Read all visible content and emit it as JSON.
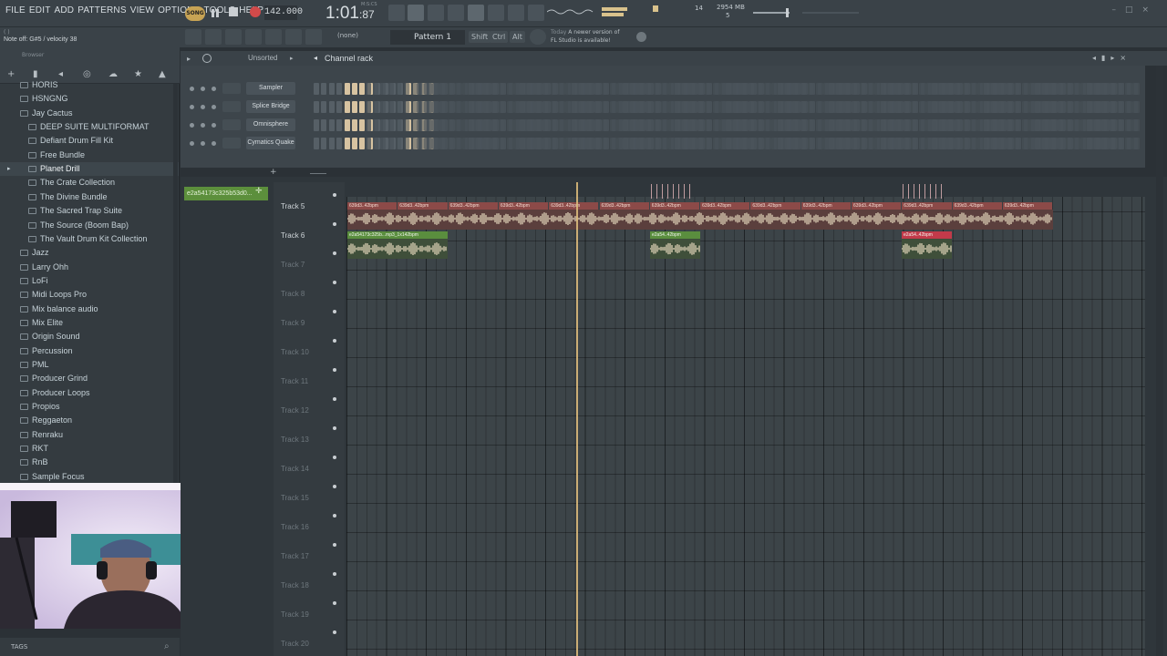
{
  "menu": [
    "FILE",
    "EDIT",
    "ADD",
    "PATTERNS",
    "VIEW",
    "OPTIONS",
    "TOOLS",
    "HELP"
  ],
  "transport": {
    "mode": "SONG",
    "tempo": "142.000",
    "time_label": "M:S:CS",
    "time_main": "1:01",
    "time_cs": ":87",
    "poly": "14",
    "cpu_mem": "2954 MB",
    "cpu_num": "5"
  },
  "hint": {
    "top": "( )",
    "text": "Note off: G#5 / velocity 38"
  },
  "toolbar2": {
    "snap": "(none)",
    "pattern": "Pattern 1",
    "keys": [
      "Shift",
      "Ctrl",
      "Alt"
    ],
    "news_time": "Today",
    "news_line1": "A newer version of",
    "news_line2": "FL Studio is available!"
  },
  "browser": {
    "title": "Browser",
    "items": [
      {
        "label": "HORIS",
        "level": 1,
        "folder": true
      },
      {
        "label": "HSNGNG",
        "level": 1,
        "folder": true
      },
      {
        "label": "Jay Cactus",
        "level": 1,
        "folder": true,
        "open": true
      },
      {
        "label": "DEEP SUITE MULTIFORMAT",
        "level": 2,
        "folder": true
      },
      {
        "label": "Defiant Drum Fill Kit",
        "level": 2,
        "folder": true
      },
      {
        "label": "Free Bundle",
        "level": 2,
        "folder": true
      },
      {
        "label": "Planet Drill",
        "level": 2,
        "folder": true,
        "highlight": true
      },
      {
        "label": "The Crate Collection",
        "level": 2,
        "folder": true
      },
      {
        "label": "The Divine Bundle",
        "level": 2,
        "folder": true
      },
      {
        "label": "The Sacred Trap Suite",
        "level": 2,
        "folder": true
      },
      {
        "label": "The Source (Boom Bap)",
        "level": 2,
        "folder": true
      },
      {
        "label": "The Vault Drum Kit Collection",
        "level": 2,
        "folder": true
      },
      {
        "label": "Jazz",
        "level": 1,
        "folder": true
      },
      {
        "label": "Larry Ohh",
        "level": 1,
        "folder": true
      },
      {
        "label": "LoFi",
        "level": 1,
        "folder": true
      },
      {
        "label": "Midi Loops Pro",
        "level": 1,
        "folder": true
      },
      {
        "label": "Mix balance audio",
        "level": 1,
        "folder": true
      },
      {
        "label": "Mix Elite",
        "level": 1,
        "folder": true
      },
      {
        "label": "Origin Sound",
        "level": 1,
        "folder": true
      },
      {
        "label": "Percussion",
        "level": 1,
        "folder": true
      },
      {
        "label": "PML",
        "level": 1,
        "folder": true
      },
      {
        "label": "Producer Grind",
        "level": 1,
        "folder": true
      },
      {
        "label": "Producer Loops",
        "level": 1,
        "folder": true
      },
      {
        "label": "Propios",
        "level": 1,
        "folder": true
      },
      {
        "label": "Reggaeton",
        "level": 1,
        "folder": true
      },
      {
        "label": "Renraku",
        "level": 1,
        "folder": true
      },
      {
        "label": "RKT",
        "level": 1,
        "folder": true
      },
      {
        "label": "RnB",
        "level": 1,
        "folder": true
      },
      {
        "label": "Sample Focus",
        "level": 1,
        "folder": true
      }
    ],
    "tags": "TAGS"
  },
  "channel_rack": {
    "title": "Channel rack",
    "sort": "Unsorted",
    "channels": [
      {
        "name": "Sampler",
        "steps": [
          0,
          0,
          0,
          0,
          1,
          1,
          1,
          1,
          0,
          0,
          0,
          0,
          1,
          1,
          1,
          1
        ]
      },
      {
        "name": "Splice Bridge",
        "steps": [
          0,
          0,
          0,
          0,
          1,
          1,
          1,
          1,
          0,
          0,
          0,
          0,
          1,
          1,
          1,
          1
        ]
      },
      {
        "name": "Omnisphere",
        "steps": [
          0,
          0,
          0,
          0,
          1,
          1,
          1,
          1,
          0,
          0,
          0,
          0,
          1,
          1,
          1,
          1
        ]
      },
      {
        "name": "Cymatics Quake",
        "steps": [
          0,
          0,
          0,
          0,
          1,
          1,
          1,
          1,
          0,
          0,
          0,
          0,
          1,
          1,
          1,
          1
        ]
      }
    ]
  },
  "playlist": {
    "pattern_selector": "e2a54173c325b53d0...",
    "tracks": [
      "Track 5",
      "Track 6",
      "Track 7",
      "Track 8",
      "Track 9",
      "Track 10",
      "Track 11",
      "Track 12",
      "Track 13",
      "Track 14",
      "Track 15",
      "Track 16",
      "Track 17",
      "Track 18",
      "Track 19",
      "Track 20"
    ],
    "active_tracks": 2,
    "track5_clip_label": "639d3..42bpm",
    "track6_clips": [
      {
        "label": "e2a54173c325b...mp3_1x142bpm",
        "color": "#5a8e3e"
      },
      {
        "label": "e2a54..42bpm",
        "color": "#5a8e3e"
      },
      {
        "label": "e2a54..42bpm",
        "color": "#c23a4a"
      }
    ],
    "playhead_color": "#d9b97a"
  }
}
